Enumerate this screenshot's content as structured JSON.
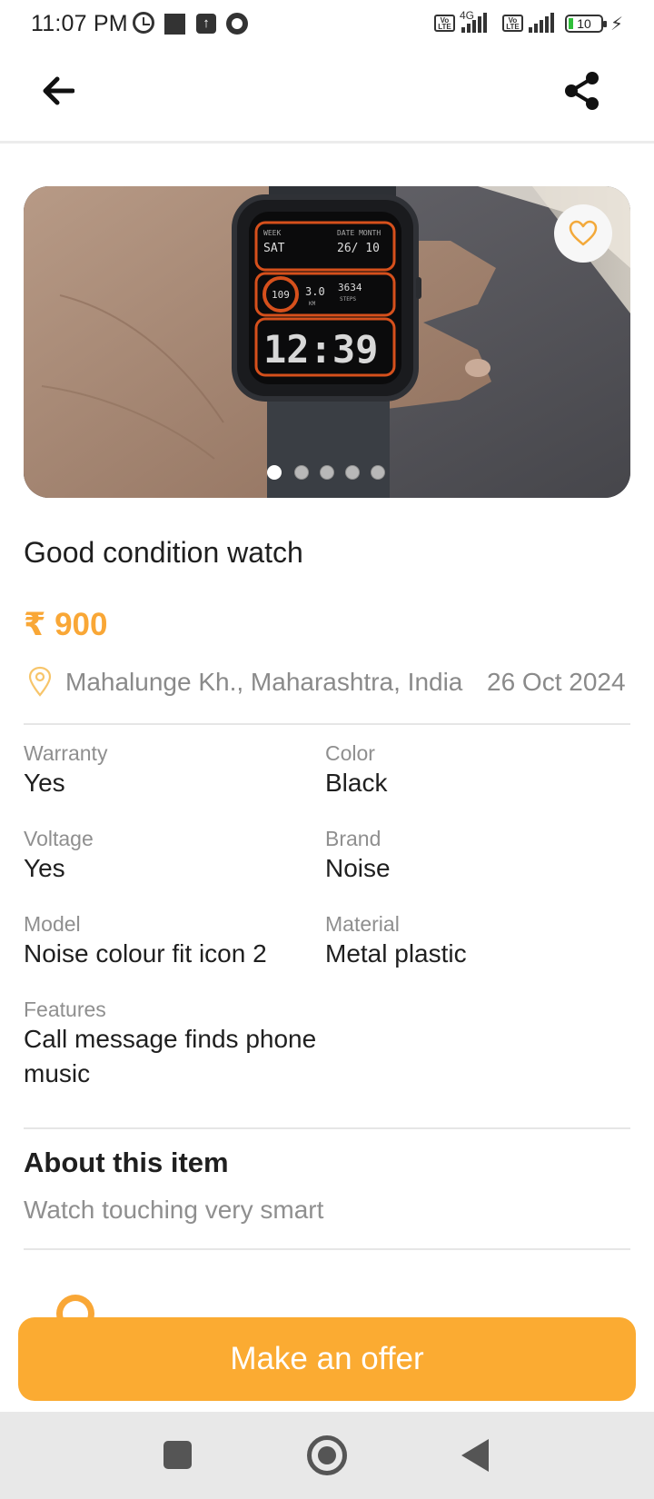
{
  "status_bar": {
    "time": "11:07 PM",
    "network": "4G",
    "volte_label": "Vo LTE",
    "battery": "10",
    "icons": [
      "alarm-icon",
      "square-icon",
      "upload-icon",
      "shutter-icon",
      "volte-icon",
      "signal-icon",
      "battery-icon",
      "charging-icon"
    ]
  },
  "app_bar": {
    "icons": [
      "arrow-left-icon",
      "share-icon"
    ]
  },
  "gallery": {
    "image_count": 5,
    "active_index": 0,
    "watch_face": {
      "day": "SAT",
      "date": "26/ 10",
      "heart_rate": "109",
      "distance": "3.0",
      "steps": "3634",
      "time": "12:39",
      "week_label": "WEEK",
      "date_label": "DATE MONTH",
      "km_label": "KM",
      "steps_label": "STEPS"
    },
    "icons": [
      "heart-outline-icon"
    ]
  },
  "listing": {
    "title": "Good condition watch",
    "price": "₹ 900",
    "location": "Mahalunge Kh., Maharashtra, India",
    "date": "26 Oct 2024"
  },
  "specs": [
    {
      "label": "Warranty",
      "value": "Yes"
    },
    {
      "label": "Color",
      "value": "Black"
    },
    {
      "label": "Voltage",
      "value": "Yes"
    },
    {
      "label": "Brand",
      "value": "Noise"
    },
    {
      "label": "Model",
      "value": "Noise colour fit icon 2"
    },
    {
      "label": "Material",
      "value": "Metal plastic"
    },
    {
      "label": "Features",
      "value": "Call message finds phone music"
    }
  ],
  "about": {
    "title": "About this item",
    "text": "Watch touching very smart"
  },
  "cta": {
    "label": "Make an offer"
  },
  "colors": {
    "accent": "#fbab32",
    "price": "#f9a736",
    "muted_text": "#8f8f8f"
  }
}
